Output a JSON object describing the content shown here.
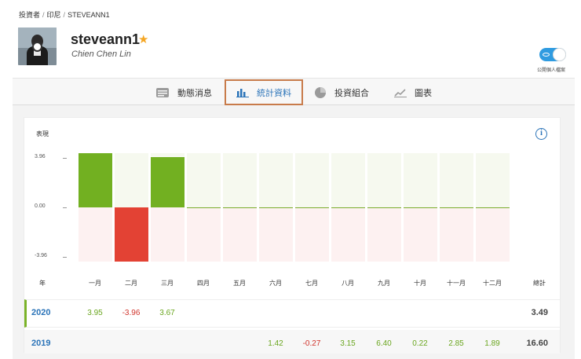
{
  "breadcrumb": [
    "投資者",
    "印尼",
    "STEVEANN1"
  ],
  "profile": {
    "username": "steveann1",
    "real_name": "Chien Chen Lin",
    "star_icon": "star-icon",
    "star_color": "#f5a623"
  },
  "privacy_toggle": {
    "label": "公開個人檔案",
    "on": true,
    "color": "#2f9be0"
  },
  "tabs": [
    {
      "label": "動態消息",
      "icon": "news-feed-icon",
      "active": false
    },
    {
      "label": "統計資料",
      "icon": "bar-chart-icon",
      "active": true
    },
    {
      "label": "投資組合",
      "icon": "pie-chart-icon",
      "active": false
    },
    {
      "label": "圖表",
      "icon": "line-chart-icon",
      "active": false
    }
  ],
  "performance": {
    "title": "表現",
    "year_header": "年",
    "total_header": "總計",
    "rows": [
      {
        "year": "2020",
        "values": [
          "3.95",
          "-3.96",
          "3.67",
          "",
          "",
          "",
          "",
          "",
          "",
          "",
          "",
          ""
        ],
        "total": "3.49"
      },
      {
        "year": "2019",
        "values": [
          "",
          "",
          "",
          "",
          "",
          "1.42",
          "-0.27",
          "3.15",
          "6.40",
          "0.22",
          "2.85",
          "1.89"
        ],
        "total": "16.60"
      }
    ]
  },
  "chart_data": {
    "type": "bar",
    "categories": [
      "一月",
      "二月",
      "三月",
      "四月",
      "五月",
      "六月",
      "七月",
      "八月",
      "九月",
      "十月",
      "十一月",
      "十二月"
    ],
    "values": [
      3.95,
      -3.96,
      3.67,
      0,
      0,
      0,
      0,
      0,
      0,
      0,
      0,
      0
    ],
    "ylim": [
      -3.96,
      3.96
    ],
    "yticks": [
      "3.96",
      "0.00",
      "-3.96"
    ],
    "positive_color": "#72b021",
    "negative_color": "#e34234"
  }
}
